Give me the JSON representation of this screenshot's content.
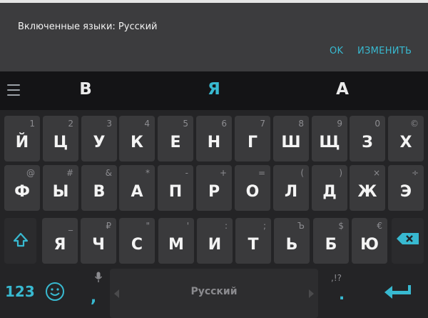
{
  "dialog": {
    "message": "Включенные языки: Русский",
    "ok_label": "OK",
    "change_label": "ИЗМЕНИТЬ"
  },
  "suggestions": [
    "В",
    "Я",
    "А"
  ],
  "keyboard": {
    "row1": [
      {
        "main": "Й",
        "hint": "1"
      },
      {
        "main": "Ц",
        "hint": "2"
      },
      {
        "main": "У",
        "hint": "3"
      },
      {
        "main": "К",
        "hint": "4"
      },
      {
        "main": "Е",
        "hint": "5"
      },
      {
        "main": "Н",
        "hint": "6"
      },
      {
        "main": "Г",
        "hint": "7"
      },
      {
        "main": "Ш",
        "hint": "8"
      },
      {
        "main": "Щ",
        "hint": "9"
      },
      {
        "main": "З",
        "hint": "0"
      },
      {
        "main": "Х",
        "hint": "©"
      }
    ],
    "row2": [
      {
        "main": "Ф",
        "hint": "@"
      },
      {
        "main": "Ы",
        "hint": "#"
      },
      {
        "main": "В",
        "hint": "&"
      },
      {
        "main": "А",
        "hint": "*"
      },
      {
        "main": "П",
        "hint": "-"
      },
      {
        "main": "Р",
        "hint": "+"
      },
      {
        "main": "О",
        "hint": "="
      },
      {
        "main": "Л",
        "hint": "("
      },
      {
        "main": "Д",
        "hint": ")"
      },
      {
        "main": "Ж",
        "hint": "×"
      },
      {
        "main": "Э",
        "hint": "÷"
      }
    ],
    "row3": [
      {
        "main": "Я",
        "hint": "_"
      },
      {
        "main": "Ч",
        "hint": "₽"
      },
      {
        "main": "С",
        "hint": "\""
      },
      {
        "main": "М",
        "hint": "'"
      },
      {
        "main": "И",
        "hint": ":"
      },
      {
        "main": "Т",
        "hint": ";"
      },
      {
        "main": "Ь",
        "hint": "Ъ"
      },
      {
        "main": "Б",
        "hint": "$"
      },
      {
        "main": "Ю",
        "hint": "€"
      }
    ],
    "symbols_label": "123",
    "comma": ",",
    "space_label": "Русский",
    "period": ".",
    "period_hint": ",!?"
  },
  "colors": {
    "accent": "#38b9d0",
    "key": "#3a3a3c",
    "keyboard_bg": "#242426"
  },
  "icons": [
    "menu-icon",
    "shift-icon",
    "backspace-icon",
    "emoji-icon",
    "mic-icon",
    "enter-icon"
  ]
}
